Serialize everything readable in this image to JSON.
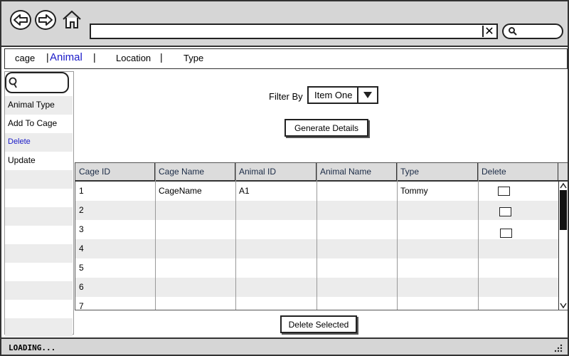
{
  "tabs": [
    {
      "label": "cage"
    },
    {
      "label": "Animal"
    },
    {
      "label": "Location"
    },
    {
      "label": "Type"
    }
  ],
  "tab_separators": [
    "|",
    "|",
    "|"
  ],
  "sidebar": {
    "items": [
      {
        "label": "Animal Type"
      },
      {
        "label": "Add To Cage"
      },
      {
        "label": "Delete"
      },
      {
        "label": "Update"
      },
      {
        "label": ""
      },
      {
        "label": ""
      },
      {
        "label": ""
      },
      {
        "label": ""
      },
      {
        "label": ""
      },
      {
        "label": ""
      },
      {
        "label": ""
      },
      {
        "label": ""
      },
      {
        "label": ""
      }
    ]
  },
  "filter": {
    "label": "Filter By",
    "selected": "Item One"
  },
  "buttons": {
    "generate": "Generate Details",
    "delete_selected": "Delete Selected"
  },
  "table": {
    "columns": [
      "Cage ID",
      "Cage Name",
      "Animal ID",
      "Animal Name",
      "Type",
      "Delete"
    ],
    "rows": [
      {
        "cage_id": "1",
        "cage_name": "CageName",
        "animal_id": "A1",
        "animal_name": "",
        "type": "Tommy",
        "delete_checked": false
      },
      {
        "cage_id": "2",
        "cage_name": "",
        "animal_id": "",
        "animal_name": "",
        "type": "",
        "delete_checked": false
      },
      {
        "cage_id": "3",
        "cage_name": "",
        "animal_id": "",
        "animal_name": "",
        "type": "",
        "delete_checked": false
      },
      {
        "cage_id": "4",
        "cage_name": "",
        "animal_id": "",
        "animal_name": "",
        "type": ""
      },
      {
        "cage_id": "5",
        "cage_name": "",
        "animal_id": "",
        "animal_name": "",
        "type": ""
      },
      {
        "cage_id": "6",
        "cage_name": "",
        "animal_id": "",
        "animal_name": "",
        "type": ""
      },
      {
        "cage_id": "7",
        "cage_name": "",
        "animal_id": "",
        "animal_name": "",
        "type": ""
      }
    ]
  },
  "status": {
    "text": "LOADING..."
  },
  "icons": {
    "back": "back-arrow-icon",
    "forward": "forward-arrow-icon",
    "home": "home-icon",
    "search": "search-icon",
    "clear": "close-icon",
    "dropdown": "triangle-down-icon",
    "resize": "resize-grip-icon"
  },
  "colors": {
    "chrome": "#d6d6d6",
    "active_tab": "#1a1ac8",
    "row_alt": "#ececec"
  }
}
